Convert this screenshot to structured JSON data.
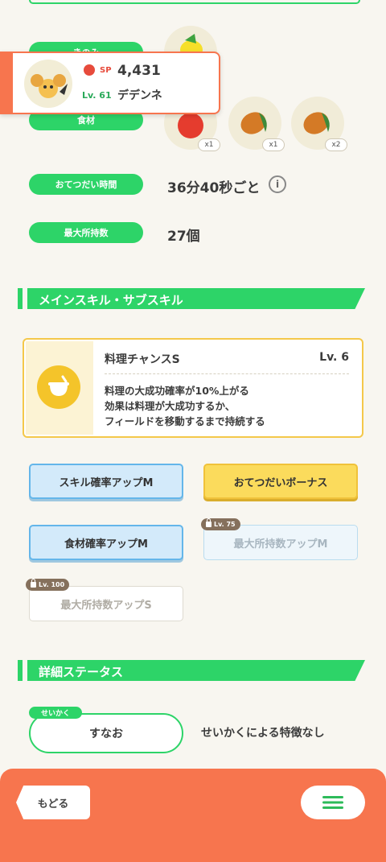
{
  "stats": {
    "berry_label": "きのみ",
    "ingredient_label": "食材",
    "help_time_label": "おてつだい時間",
    "help_time_value": "36分40秒ごと",
    "max_carry_label": "最大所持数",
    "max_carry_value": "27個",
    "ingredients": [
      {
        "icon": "apple-icon",
        "count": "x1"
      },
      {
        "icon": "cacao-icon",
        "count": "x1"
      },
      {
        "icon": "cacao-icon",
        "count": "x2"
      }
    ]
  },
  "pokemon": {
    "sp_label": "SP",
    "sp_value": "4,431",
    "level": "Lv. 61",
    "name": "デデンネ"
  },
  "skills_section": {
    "title": "メインスキル・サブスキル",
    "main_skill": {
      "name": "料理チャンスS",
      "level": "Lv. 6",
      "desc_line1": "料理の大成功確率が10%上がる",
      "desc_line2": "効果は料理が大成功するか、",
      "desc_line3": "フィールドを移動するまで持続する"
    },
    "sub_skills": [
      {
        "label": "スキル確率アップM"
      },
      {
        "label": "おてつだいボーナス"
      },
      {
        "label": "食材確率アップM"
      },
      {
        "label": "最大所持数アップM",
        "lock": "Lv. 75"
      },
      {
        "label": "最大所持数アップS",
        "lock": "Lv. 100"
      }
    ]
  },
  "details_section": {
    "title": "詳細ステータス",
    "nature_tag": "せいかく",
    "nature": "すなお",
    "nature_desc": "せいかくによる特徴なし"
  },
  "footer": {
    "back_label": "もどる"
  },
  "colors": {
    "accent_green": "#2dd468",
    "footer_orange": "#f7754e",
    "skill_yellow": "#f4c42a"
  }
}
